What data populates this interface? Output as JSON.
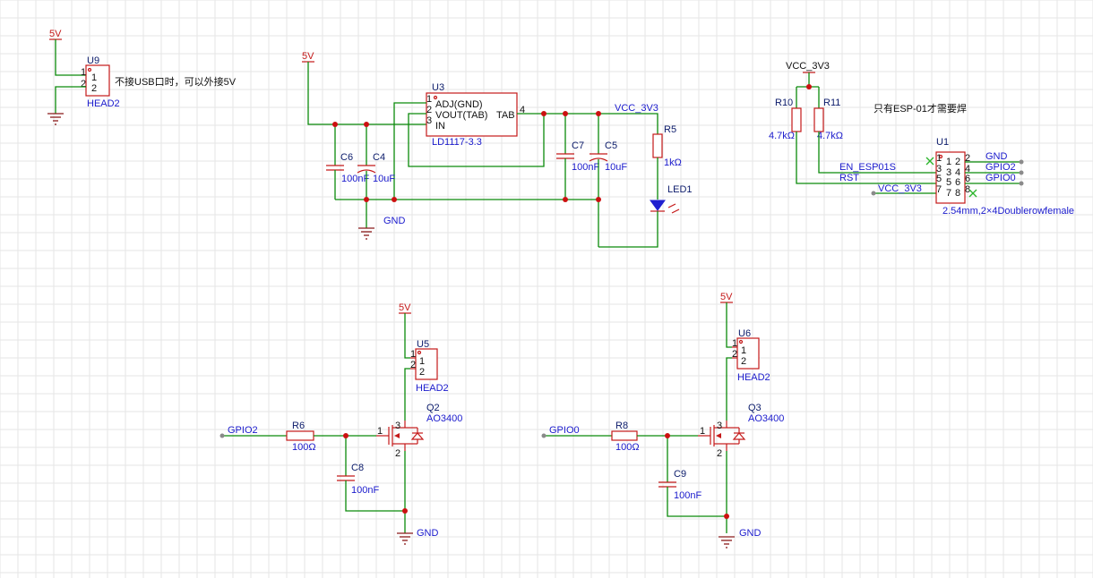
{
  "colors": {
    "wire": "#0b8a0b",
    "part": "#c41919",
    "designator": "#0a1a6a",
    "value": "#1a1acc",
    "junction": "#cc1010",
    "grid": "#e6e6e6"
  },
  "power": {
    "v5": "5V",
    "vcc3v3": "VCC_3V3",
    "gnd": "GND"
  },
  "u9": {
    "ref": "U9",
    "value": "HEAD2",
    "pin1": "1",
    "pin2": "2",
    "note": "不接USB口时，可以外接5V"
  },
  "u3": {
    "ref": "U3",
    "value": "LD1117-3.3",
    "pin_adj": "ADJ(GND)",
    "pin_vout": "VOUT(TAB)",
    "pin_in": "IN",
    "pin_tab": "TAB",
    "n1": "1",
    "n2": "2",
    "n3": "3",
    "n4": "4"
  },
  "caps": {
    "c6_ref": "C6",
    "c6_val": "100nF",
    "c4_ref": "C4",
    "c4_val": "10uF",
    "c7_ref": "C7",
    "c7_val": "100nF",
    "c5_ref": "C5",
    "c5_val": "10uF",
    "c8_ref": "C8",
    "c8_val": "100nF",
    "c9_ref": "C9",
    "c9_val": "100nF"
  },
  "r5": {
    "ref": "R5",
    "value": "1kΩ"
  },
  "led1": {
    "ref": "LED1"
  },
  "r10": {
    "ref": "R10",
    "value": "4.7kΩ"
  },
  "r11": {
    "ref": "R11",
    "value": "4.7kΩ"
  },
  "esp_note": "只有ESP-01才需要焊",
  "u1": {
    "ref": "U1",
    "value": "2.54mm,2×4Doublerowfemale",
    "pins": [
      "1",
      "2",
      "3",
      "4",
      "5",
      "6",
      "7",
      "8"
    ],
    "net_gnd": "GND",
    "net_gpio2": "GPIO2",
    "net_gpio0": "GPIO0",
    "net_en": "EN_ESP01S",
    "net_rst": "RST",
    "net_vcc": "VCC_3V3"
  },
  "q2": {
    "ref": "Q2",
    "value": "AO3400",
    "pin1": "1",
    "pin2": "2",
    "pin3": "3",
    "u5_ref": "U5",
    "u5_val": "HEAD2",
    "r_ref": "R6",
    "r_val": "100Ω",
    "net": "GPIO2"
  },
  "q3": {
    "ref": "Q3",
    "value": "AO3400",
    "pin1": "1",
    "pin2": "2",
    "pin3": "3",
    "u6_ref": "U6",
    "u6_val": "HEAD2",
    "r_ref": "R8",
    "r_val": "100Ω",
    "net": "GPIO0"
  }
}
